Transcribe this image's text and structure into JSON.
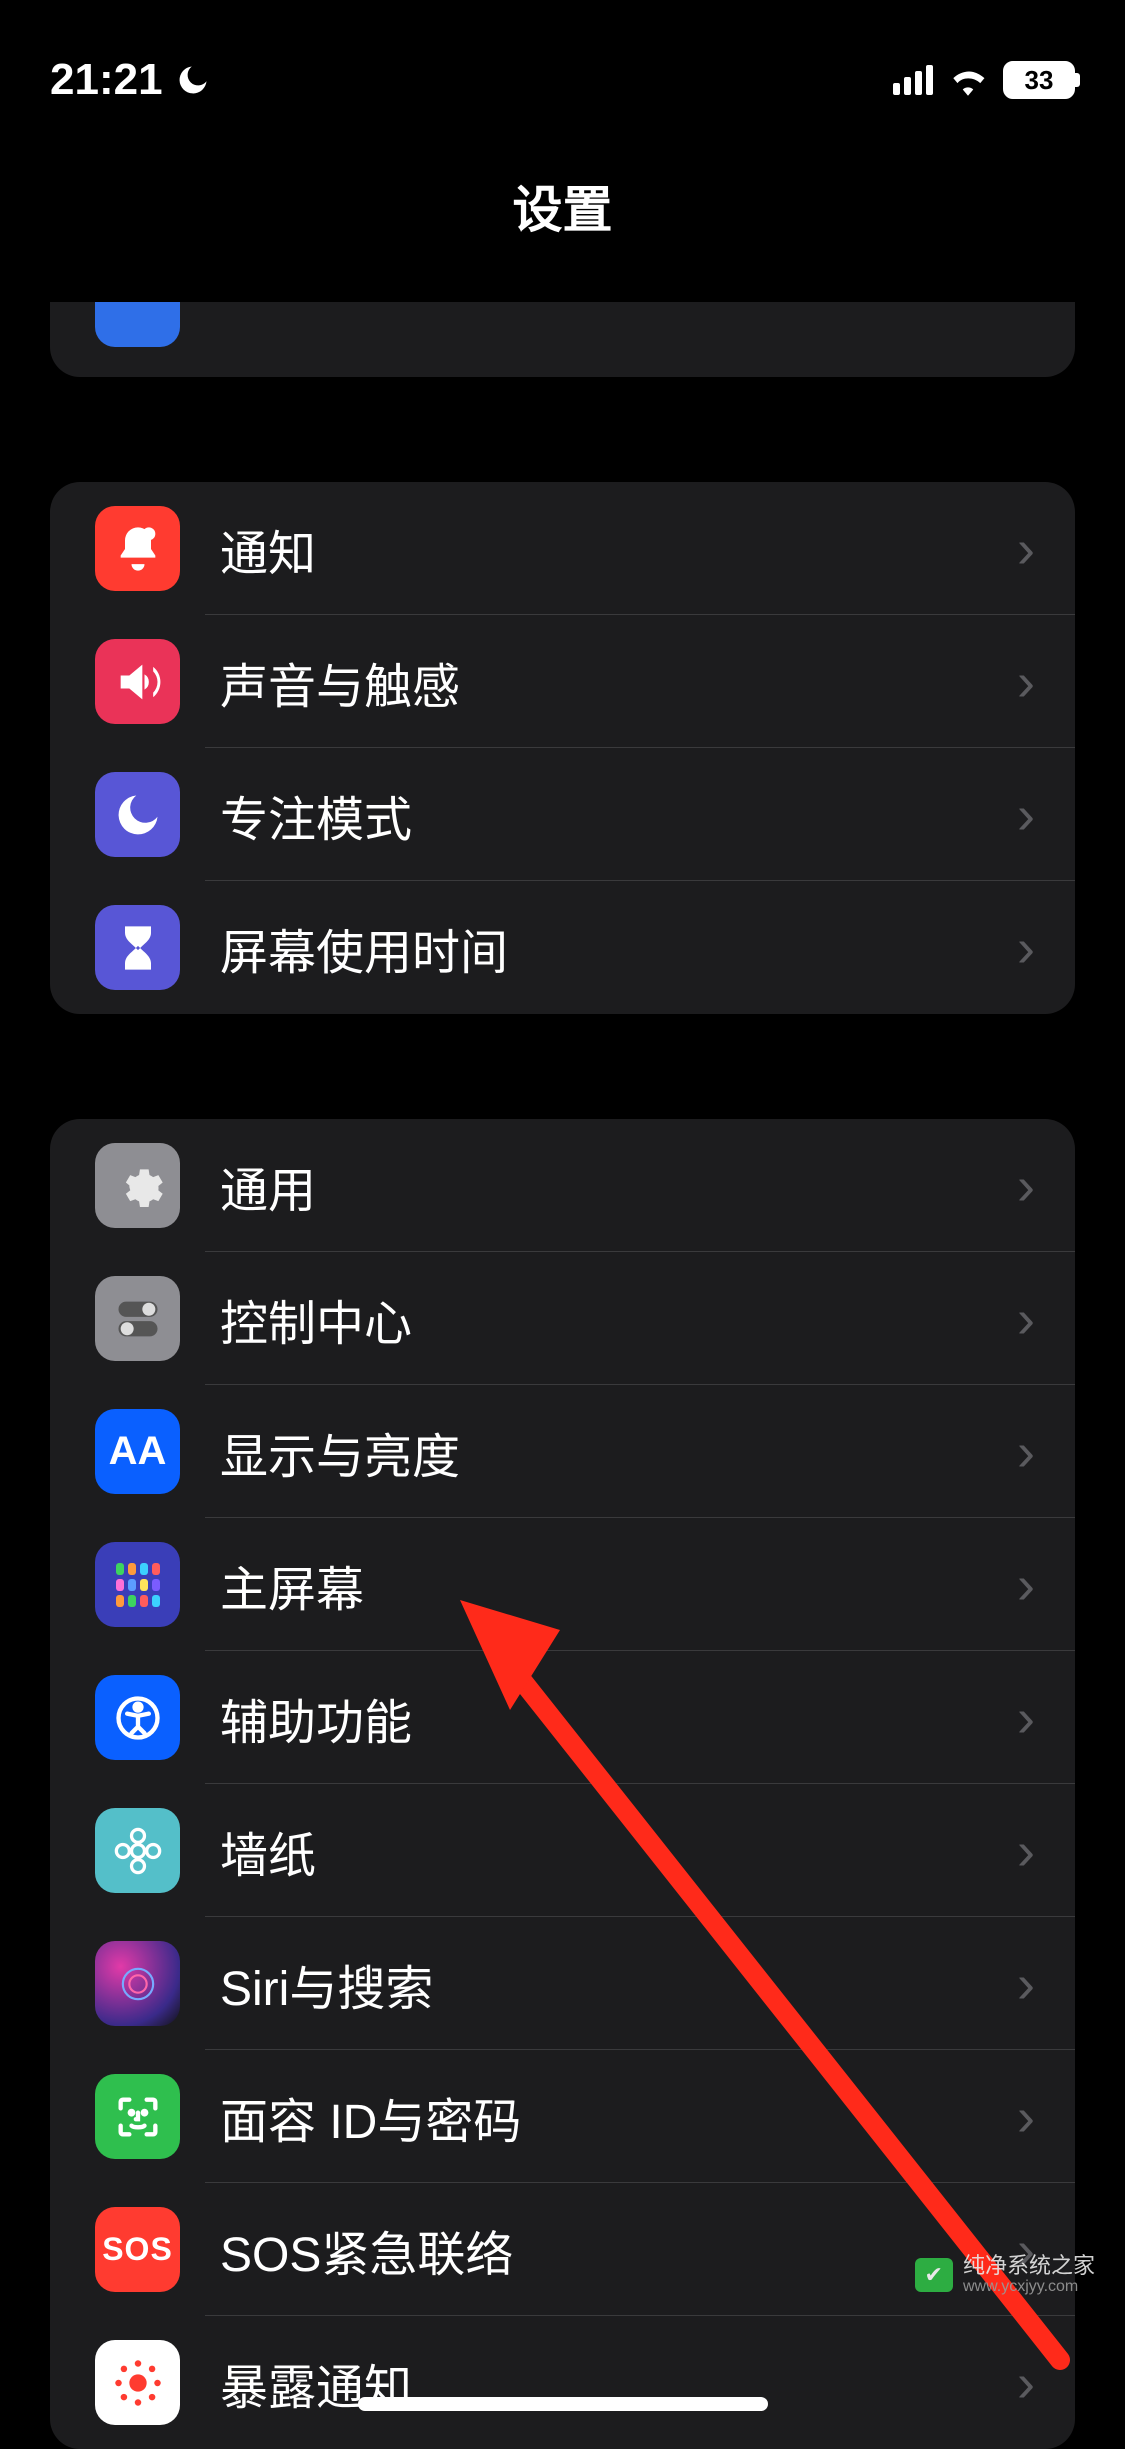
{
  "status": {
    "time": "21:21",
    "battery_pct": "33"
  },
  "nav": {
    "title": "设置"
  },
  "groups": [
    {
      "id": "g1",
      "items": [
        {
          "id": "notify",
          "label": "通知"
        },
        {
          "id": "sound",
          "label": "声音与触感"
        },
        {
          "id": "focus",
          "label": "专注模式"
        },
        {
          "id": "screentime",
          "label": "屏幕使用时间"
        }
      ]
    },
    {
      "id": "g2",
      "items": [
        {
          "id": "general",
          "label": "通用"
        },
        {
          "id": "control",
          "label": "控制中心"
        },
        {
          "id": "display",
          "label": "显示与亮度"
        },
        {
          "id": "home",
          "label": "主屏幕"
        },
        {
          "id": "access",
          "label": "辅助功能"
        },
        {
          "id": "wallpaper",
          "label": "墙纸"
        },
        {
          "id": "siri",
          "label": "Siri与搜索"
        },
        {
          "id": "faceid",
          "label": "面容 ID与密码"
        },
        {
          "id": "sos",
          "label": "SOS紧急联络"
        },
        {
          "id": "exposure",
          "label": "暴露通知"
        }
      ]
    }
  ],
  "display_icon_text": "AA",
  "sos_icon_text": "SOS",
  "annotation": {
    "arrow_target": "辅助功能"
  },
  "watermark": {
    "brand": "纯净系统之家",
    "url": "www.ycxjyy.com"
  }
}
